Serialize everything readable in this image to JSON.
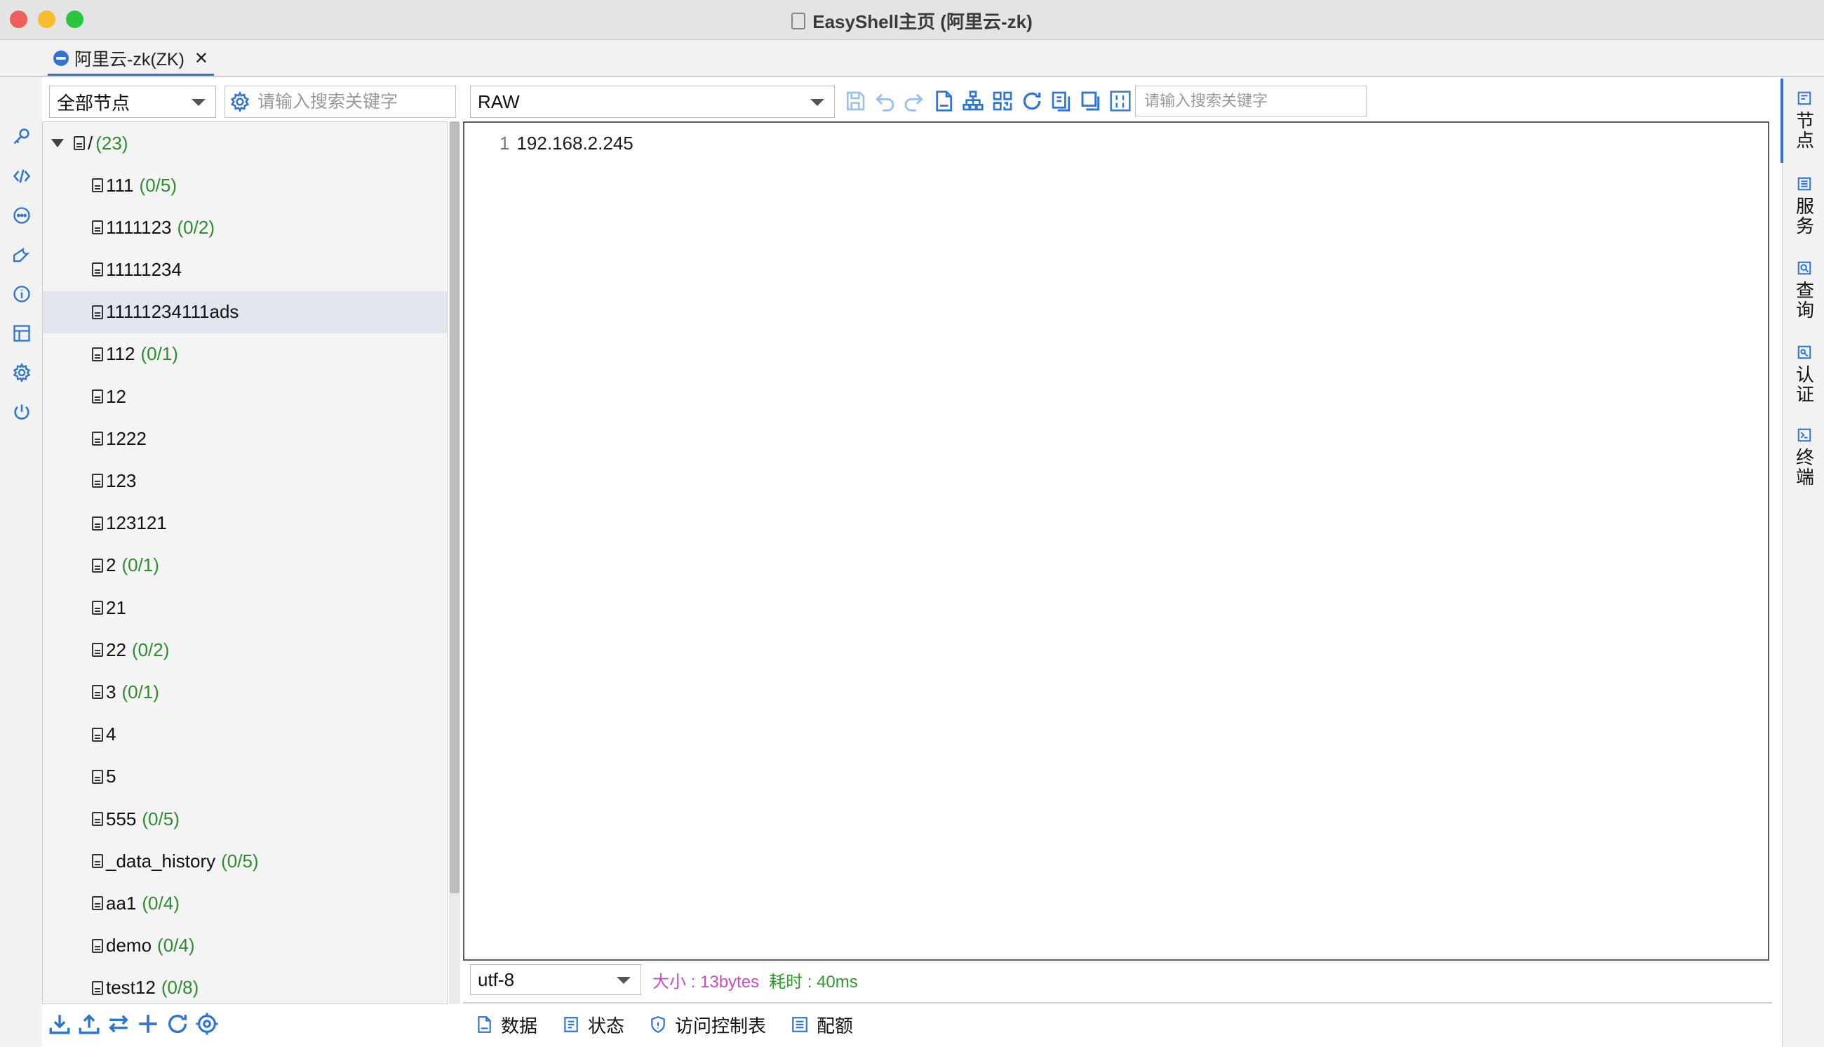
{
  "window": {
    "title": "EasyShell主页 (阿里云-zk)",
    "traffic_lights": {
      "close": "#ee5f57",
      "minimize": "#f6be2f",
      "zoom": "#29c741"
    }
  },
  "tab": {
    "label": "阿里云-zk(ZK)",
    "close": "✕"
  },
  "left_rail": {
    "icons": [
      "key-icon",
      "code-icon",
      "chat-icon",
      "wrench-icon",
      "info-icon",
      "layout-icon",
      "gear-icon",
      "power-icon"
    ]
  },
  "tree_panel": {
    "filter_selected": "全部节点",
    "search_placeholder": "请输入搜索关键字",
    "root": {
      "label": "/",
      "count": "(23)"
    },
    "nodes": [
      {
        "label": "111",
        "count": "(0/5)"
      },
      {
        "label": "1111123",
        "count": "(0/2)"
      },
      {
        "label": "11111234",
        "count": ""
      },
      {
        "label": "11111234111ads",
        "count": "",
        "selected": true
      },
      {
        "label": "112",
        "count": "(0/1)"
      },
      {
        "label": "12",
        "count": ""
      },
      {
        "label": "1222",
        "count": ""
      },
      {
        "label": "123",
        "count": ""
      },
      {
        "label": "123121",
        "count": ""
      },
      {
        "label": "2",
        "count": "(0/1)"
      },
      {
        "label": "21",
        "count": ""
      },
      {
        "label": "22",
        "count": "(0/2)"
      },
      {
        "label": "3",
        "count": "(0/1)"
      },
      {
        "label": "4",
        "count": ""
      },
      {
        "label": "5",
        "count": ""
      },
      {
        "label": "555",
        "count": "(0/5)"
      },
      {
        "label": "_data_history",
        "count": "(0/5)"
      },
      {
        "label": "aa1",
        "count": "(0/4)"
      },
      {
        "label": "demo",
        "count": "(0/4)"
      },
      {
        "label": "test12",
        "count": "(0/8)"
      }
    ],
    "bottom_toolbar": [
      "import-icon",
      "export-icon",
      "transfer-icon",
      "add-icon",
      "refresh-icon",
      "locate-icon"
    ]
  },
  "editor": {
    "format_selected": "RAW",
    "search_placeholder": "请输入搜索关键字",
    "toolbar": [
      "save-icon",
      "undo-icon",
      "redo-icon",
      "file-icon",
      "tree-icon",
      "qrcode-icon",
      "refresh-icon",
      "copy-icon",
      "window-icon",
      "binary-icon"
    ],
    "lines": [
      {
        "no": "1",
        "text": "192.168.2.245"
      }
    ],
    "encoding": "utf-8",
    "size_label": "大小 : 13bytes",
    "time_label": "耗时 : 40ms",
    "size_color": "#c64fc6",
    "time_color": "#2e9a2e"
  },
  "bottom_tabs": [
    {
      "label": "数据",
      "icon": "data-icon"
    },
    {
      "label": "状态",
      "icon": "status-icon"
    },
    {
      "label": "访问控制表",
      "icon": "shield-icon"
    },
    {
      "label": "配额",
      "icon": "quota-icon"
    }
  ],
  "right_rail": [
    {
      "label": "节点",
      "icon": "node-icon",
      "active": true
    },
    {
      "label": "服务",
      "icon": "service-icon"
    },
    {
      "label": "查询",
      "icon": "query-icon"
    },
    {
      "label": "认证",
      "icon": "auth-icon"
    },
    {
      "label": "终端",
      "icon": "terminal-icon"
    }
  ],
  "accent_color": "#2f74d0"
}
